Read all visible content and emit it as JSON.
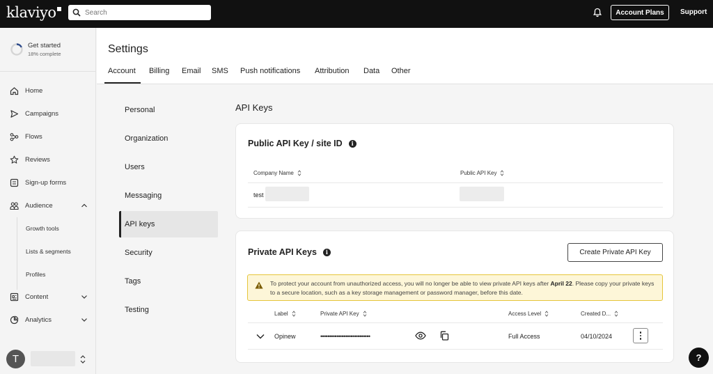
{
  "topbar": {
    "logo": "klaviyo",
    "search_placeholder": "Search",
    "account_plans": "Account Plans",
    "support": "Support"
  },
  "sidebar": {
    "get_started": {
      "title": "Get started",
      "subtitle": "18% complete",
      "progress": 0.18
    },
    "items": [
      {
        "label": "Home",
        "icon": "home-icon"
      },
      {
        "label": "Campaigns",
        "icon": "send-icon"
      },
      {
        "label": "Flows",
        "icon": "flows-icon"
      },
      {
        "label": "Reviews",
        "icon": "star-icon"
      },
      {
        "label": "Sign-up forms",
        "icon": "form-icon"
      },
      {
        "label": "Audience",
        "icon": "audience-icon"
      },
      {
        "label": "Content",
        "icon": "content-icon"
      },
      {
        "label": "Analytics",
        "icon": "analytics-icon"
      }
    ],
    "audience_sub": [
      "Growth tools",
      "Lists & segments",
      "Profiles"
    ],
    "avatar_initial": "T"
  },
  "header": {
    "title": "Settings",
    "tabs": [
      "Account",
      "Billing",
      "Email",
      "SMS",
      "Push notifications",
      "Attribution",
      "Data",
      "Other"
    ]
  },
  "subnav": [
    "Personal",
    "Organization",
    "Users",
    "Messaging",
    "API keys",
    "Security",
    "Tags",
    "Testing"
  ],
  "main": {
    "title": "API Keys",
    "public": {
      "title": "Public API Key / site ID",
      "columns": [
        "Company Name",
        "Public API Key"
      ],
      "row": {
        "company": "test"
      }
    },
    "private": {
      "title": "Private API Keys",
      "create_button": "Create Private API Key",
      "warning_pre": "To protect your account from unauthorized access, you will no longer be able to view private API keys after ",
      "warning_date": "April 22",
      "warning_post": ". Please copy your private keys to a secure location, such as a key storage management or password manager, before this date.",
      "columns": [
        "Label",
        "Private API Key",
        "Access Level",
        "Created D..."
      ],
      "row": {
        "label": "Opinew",
        "key": "••••••••••••••••••••••••••••",
        "access": "Full Access",
        "created": "04/10/2024"
      }
    }
  },
  "help": "?"
}
